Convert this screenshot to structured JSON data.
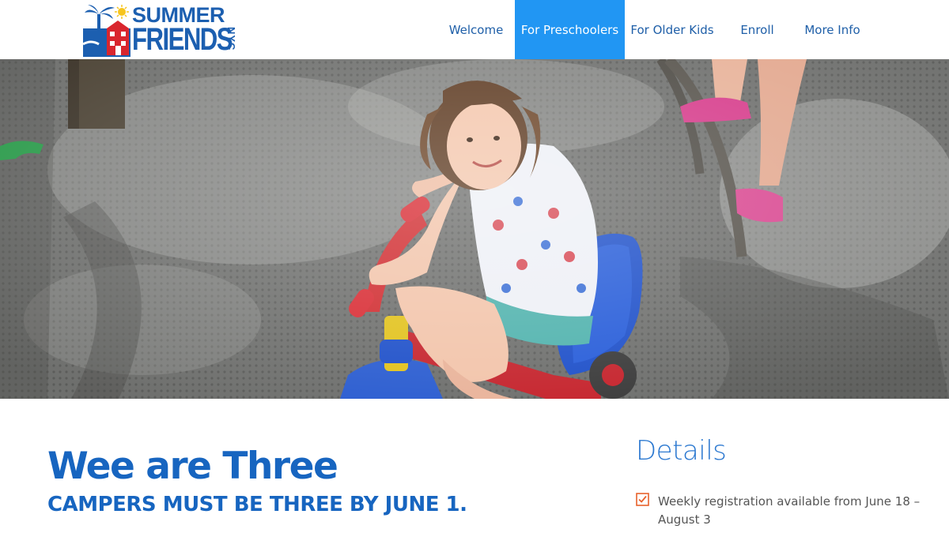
{
  "logo": {
    "line1": "SUMMER",
    "line2": "FRIENDS",
    "line3": "NYC"
  },
  "nav": {
    "items": [
      {
        "label": "Welcome",
        "active": false
      },
      {
        "label": "For Preschoolers",
        "active": true
      },
      {
        "label": "For Older Kids",
        "active": false
      },
      {
        "label": "Enroll",
        "active": false
      },
      {
        "label": "More Info",
        "active": false
      }
    ]
  },
  "hero": {
    "image": "child-riding-tricycle-photo"
  },
  "main": {
    "title": "Wee are Three",
    "subtitle": "CAMPERS MUST BE THREE BY JUNE 1."
  },
  "details": {
    "heading": "Details",
    "items": [
      {
        "icon": "checkbox-checked-icon",
        "text": "Weekly registration available from June 18 – August 3"
      }
    ]
  },
  "colors": {
    "brand_blue": "#1765c0",
    "nav_active_bg": "#2196f3",
    "check_orange": "#e8622c"
  }
}
